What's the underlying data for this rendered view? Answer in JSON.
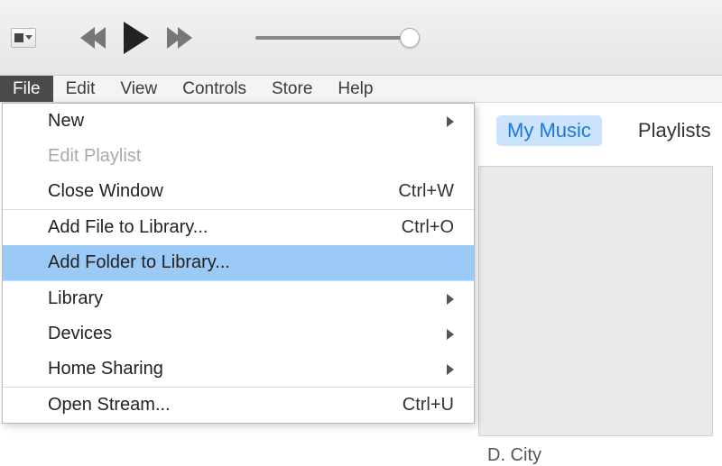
{
  "menubar": {
    "items": [
      "File",
      "Edit",
      "View",
      "Controls",
      "Store",
      "Help"
    ],
    "active_index": 0
  },
  "tabs": {
    "items": [
      "My Music",
      "Playlists"
    ],
    "active_index": 0
  },
  "dropdown": {
    "items": [
      {
        "label": "New",
        "submenu": true
      },
      {
        "label": "Edit Playlist",
        "disabled": true
      },
      {
        "label": "Close Window",
        "shortcut": "Ctrl+W"
      },
      {
        "sep": true
      },
      {
        "label": "Add File to Library...",
        "shortcut": "Ctrl+O"
      },
      {
        "label": "Add Folder to Library...",
        "highlight": true
      },
      {
        "sep": true
      },
      {
        "label": "Library",
        "submenu": true
      },
      {
        "label": "Devices",
        "submenu": true
      },
      {
        "label": "Home Sharing",
        "submenu": true
      },
      {
        "sep": true
      },
      {
        "label": "Open Stream...",
        "shortcut": "Ctrl+U"
      }
    ]
  },
  "album_caption": "D. City"
}
